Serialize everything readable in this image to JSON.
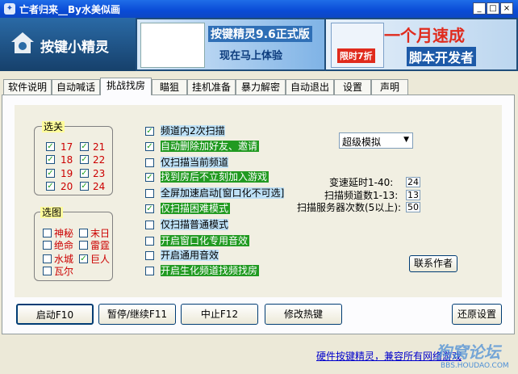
{
  "window": {
    "title": "亡者归来__By水美似画",
    "min_glyph": "_",
    "max_glyph": "□",
    "close_glyph": "×"
  },
  "banner": {
    "logo_text": "按键小精灵",
    "ad1_title": "按键精灵9.6正式版",
    "ad1_sub": "现在马上体验",
    "ad2_big": "一个月速成",
    "ad2_limit": "限时7折",
    "ad2_sub": "脚本开发者"
  },
  "tabs": [
    "软件说明",
    "自动喊话",
    "挑战找房",
    "瞄狙",
    "挂机准备",
    "暴力解密",
    "自动退出",
    "设置",
    "声明"
  ],
  "active_tab": 2,
  "level_group": {
    "title": "选关",
    "items": [
      {
        "label": "17",
        "checked": true
      },
      {
        "label": "21",
        "checked": true
      },
      {
        "label": "18",
        "checked": true
      },
      {
        "label": "22",
        "checked": true
      },
      {
        "label": "19",
        "checked": true
      },
      {
        "label": "23",
        "checked": true
      },
      {
        "label": "20",
        "checked": true
      },
      {
        "label": "24",
        "checked": true
      }
    ]
  },
  "map_group": {
    "title": "选图",
    "items": [
      {
        "label": "神秘",
        "checked": false
      },
      {
        "label": "末日",
        "checked": false
      },
      {
        "label": "绝命",
        "checked": false
      },
      {
        "label": "雷霆",
        "checked": false
      },
      {
        "label": "水城",
        "checked": false
      },
      {
        "label": "巨人",
        "checked": true
      },
      {
        "label": "瓦尔",
        "checked": false
      }
    ]
  },
  "options": [
    {
      "label": "频道内2次扫描",
      "checked": true,
      "style": "blue"
    },
    {
      "label": "自动删除加好友、邀请",
      "checked": true,
      "style": "green"
    },
    {
      "label": "仅扫描当前频道",
      "checked": false,
      "style": "blue"
    },
    {
      "label": "找到房后不立刻加入游戏",
      "checked": true,
      "style": "green"
    },
    {
      "label": "全屏加速启动[窗口化不可选]",
      "checked": false,
      "style": "blue"
    },
    {
      "label": "仅扫描困难模式",
      "checked": true,
      "style": "green"
    },
    {
      "label": "仅扫描普通模式",
      "checked": false,
      "style": "blue"
    },
    {
      "label": "开启窗口化专用音效",
      "checked": false,
      "style": "green"
    },
    {
      "label": "开启通用音效",
      "checked": false,
      "style": "blue"
    },
    {
      "label": "开启生化频道找频找房",
      "checked": false,
      "style": "green"
    }
  ],
  "mode_select": {
    "value": "超级模拟",
    "arrow": "▼"
  },
  "settings": {
    "speed_label": "变速延时1-40:",
    "speed_value": "24",
    "channels_label": "扫描频道数1-13:",
    "channels_value": "13",
    "server_label": "扫描服务器次数(5以上):",
    "server_value": "50"
  },
  "contact_button": "联系作者",
  "bottom_buttons": {
    "start": "启动F10",
    "pause": "暂停/继续F11",
    "stop": "中止F12",
    "hotkey": "修改热键",
    "restore": "还原设置"
  },
  "footer": {
    "link": "硬件按键精灵，兼容所有网络游戏",
    "watermark": "狗窝论坛",
    "watermark_sub": "BBS.HOUDAO.COM"
  },
  "colors": {
    "title_bar": "#0a4bd6",
    "tab_bg": "#fcfcfe",
    "highlight_green": "#219a21",
    "highlight_blue": "#bde0f6",
    "group_title": "#fffc9a"
  }
}
